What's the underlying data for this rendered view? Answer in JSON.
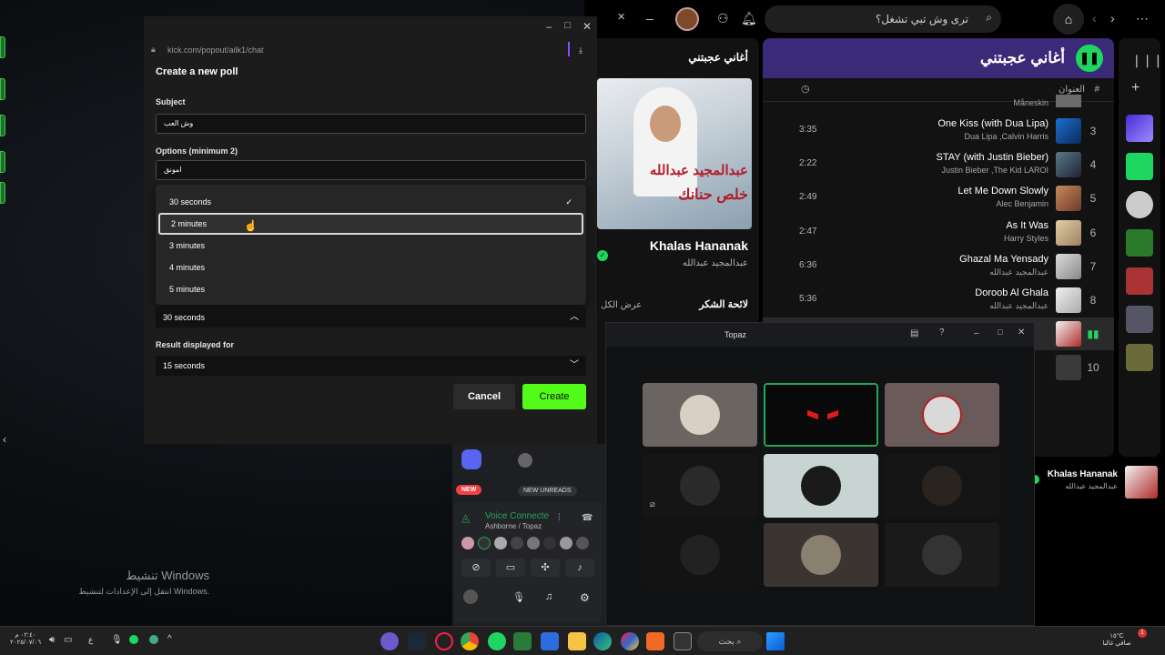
{
  "kick": {
    "url": "kick.com/popout/ailk1/chat",
    "heading": "Create a new poll",
    "subject_label": "Subject",
    "subject_value": "وش العب",
    "options_label": "Options (minimum 2)",
    "option1_value": "امونق",
    "duration_options": [
      "30 seconds",
      "2 minutes",
      "3 minutes",
      "4 minutes",
      "5 minutes"
    ],
    "duration_selected_check": "✓",
    "duration_value": "30 seconds",
    "result_label": "Result displayed for",
    "result_value": "15 seconds",
    "cancel_label": "Cancel",
    "create_label": "Create"
  },
  "spotify": {
    "search_placeholder": "ترى وش تبي تشغل؟",
    "playlist_title": "أغاني عجبتني",
    "col_num": "#",
    "col_title": "العنوان",
    "top_partial_artist": "Måneskin",
    "tracks": [
      {
        "num": "3",
        "title": "One Kiss (with Dua Lipa)",
        "artist": "Dua Lipa ,Calvin Harris",
        "duration": "3:35"
      },
      {
        "num": "4",
        "title": "STAY (with Justin Bieber)",
        "artist": "Justin Bieber ,The Kid LAROI",
        "duration": "2:22"
      },
      {
        "num": "5",
        "title": "Let Me Down Slowly",
        "artist": "Alec Benjamin",
        "duration": "2:49"
      },
      {
        "num": "6",
        "title": "As It Was",
        "artist": "Harry Styles",
        "duration": "2:47"
      },
      {
        "num": "7",
        "title": "Ghazal Ma Yensady",
        "artist": "عبدالمجيد عبدالله",
        "duration": "6:36"
      },
      {
        "num": "8",
        "title": "Doroob Al Ghala",
        "artist": "عبدالمجيد عبدالله",
        "duration": "5:36"
      },
      {
        "num": "10",
        "title": "",
        "artist": "",
        "duration": ""
      }
    ],
    "now_playing_header": "أغاني عجبتني",
    "np_song": "Khalas Hananak",
    "np_artist": "عبدالمجيد عبدالله",
    "np_art_text1": "عبدالمجيد عبدالله",
    "np_art_text2": "خلص حنانك",
    "credits_label": "لائحة الشكر",
    "show_all": "عرض الكل",
    "mini_song": "Khalas Hananak",
    "mini_artist": "عبدالمجيد عبدالله"
  },
  "discord": {
    "voice_title": "Voice Connecte",
    "voice_sub": "Ashborne / Topaz",
    "new_badge": "NEW",
    "unreads": "NEW UNREADS"
  },
  "topaz": {
    "title": "Topaz"
  },
  "desktop": {
    "activate_line1": "تنشيط Windows",
    "activate_line2": "انتقل إلى الإعدادات لتنشيط Windows."
  },
  "taskbar": {
    "search": "بحث",
    "temp": "١٥°C",
    "weather": "صافي غالبا",
    "time": "٠٢:٤٠ م",
    "date": "٢٠٢٥/٠٧/٠٦",
    "notif_count": "1"
  },
  "colors": {
    "kick_green": "#53fc18",
    "spotify_green": "#1ed760",
    "playlist_header": "#3a2a78"
  }
}
